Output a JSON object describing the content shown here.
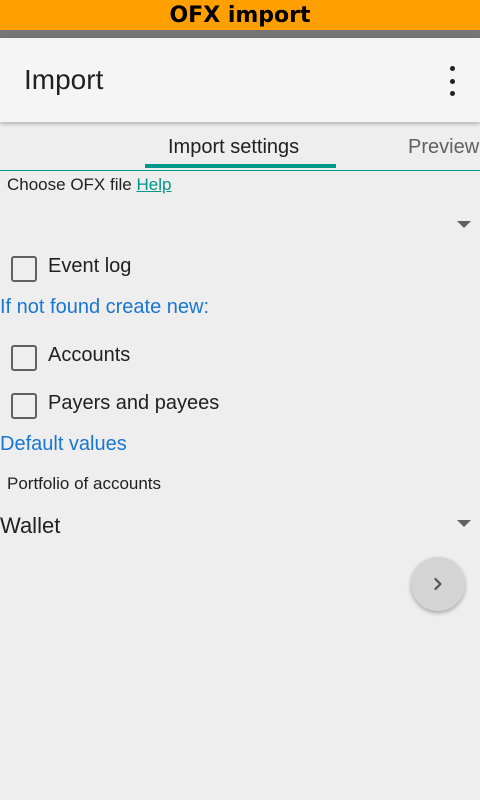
{
  "banner": {
    "title": "OFX import"
  },
  "appbar": {
    "title": "Import",
    "menu_icon": "more-vert-icon"
  },
  "tabs": [
    {
      "label": "Import settings",
      "active": true
    },
    {
      "label": "Preview",
      "active": false
    }
  ],
  "file": {
    "label": "Choose OFX file",
    "help_link": "Help",
    "value": ""
  },
  "event_log": {
    "label": "Event log",
    "checked": false
  },
  "create_new": {
    "header": "If not found create new:",
    "accounts": {
      "label": "Accounts",
      "checked": false
    },
    "payers": {
      "label": "Payers and payees",
      "checked": false
    }
  },
  "defaults": {
    "header": "Default values",
    "portfolio_label": "Portfolio of accounts",
    "portfolio_value": "Wallet"
  },
  "fab": {
    "icon": "chevron-right-icon"
  },
  "colors": {
    "banner": "#ffa000",
    "accent": "#009688",
    "section_header": "#1976d2",
    "background": "#eeeeee"
  }
}
